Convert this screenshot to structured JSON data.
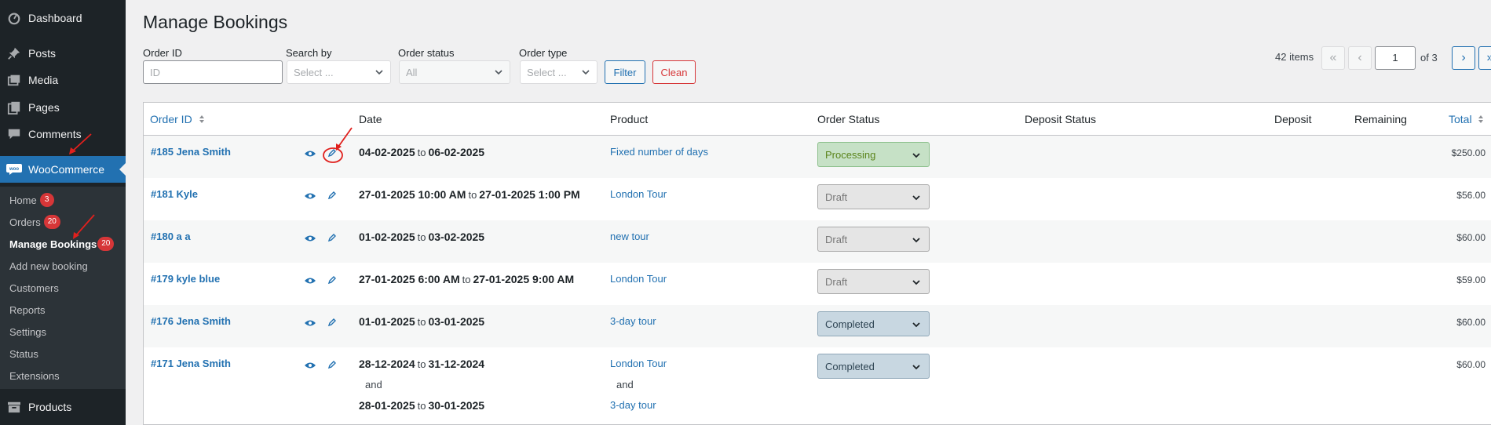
{
  "sidebar": {
    "menu": [
      {
        "label": "Dashboard",
        "icon": "dashboard-icon"
      },
      {
        "label": "Posts",
        "icon": "pin-icon"
      },
      {
        "label": "Media",
        "icon": "media-icon"
      },
      {
        "label": "Pages",
        "icon": "pages-icon"
      },
      {
        "label": "Comments",
        "icon": "comment-icon"
      },
      {
        "label": "WooCommerce",
        "icon": "woo-icon"
      }
    ],
    "submenu": [
      {
        "label": "Home",
        "badge": "3"
      },
      {
        "label": "Orders",
        "badge": "20"
      },
      {
        "label": "Manage Bookings",
        "badge": "20"
      },
      {
        "label": "Add new booking"
      },
      {
        "label": "Customers"
      },
      {
        "label": "Reports"
      },
      {
        "label": "Settings"
      },
      {
        "label": "Status"
      },
      {
        "label": "Extensions"
      }
    ],
    "products": {
      "label": "Products",
      "icon": "archive-icon"
    }
  },
  "page": {
    "title": "Manage Bookings"
  },
  "filters": {
    "order_id_label": "Order ID",
    "order_id_placeholder": "ID",
    "search_by_label": "Search by",
    "search_by_value": "Select ...",
    "order_status_label": "Order status",
    "order_status_value": "All",
    "order_type_label": "Order type",
    "order_type_value": "Select ...",
    "filter_button": "Filter",
    "clean_button": "Clean"
  },
  "pagination": {
    "items": "42 items",
    "first": "«",
    "prev": "‹",
    "current": "1",
    "of": "of 3",
    "next": "›",
    "last": "»"
  },
  "table": {
    "headers": {
      "order_id": "Order ID",
      "date": "Date",
      "product": "Product",
      "order_status": "Order Status",
      "deposit_status": "Deposit Status",
      "deposit": "Deposit",
      "remaining": "Remaining",
      "total": "Total"
    },
    "rows": [
      {
        "order": "#185 Jena Smith",
        "date1_from": "04-02-2025",
        "date1_to": "06-02-2025",
        "product1": "Fixed number of days",
        "status": "Processing",
        "total": "$250.00"
      },
      {
        "order": "#181 Kyle",
        "date1_from": "27-01-2025 10:00 AM",
        "date1_to": "27-01-2025 1:00 PM",
        "product1": "London Tour",
        "status": "Draft",
        "total": "$56.00"
      },
      {
        "order": "#180 a a",
        "date1_from": "01-02-2025",
        "date1_to": "03-02-2025",
        "product1": "new tour",
        "status": "Draft",
        "total": "$60.00"
      },
      {
        "order": "#179 kyle blue",
        "date1_from": "27-01-2025 6:00 AM",
        "date1_to": "27-01-2025 9:00 AM",
        "product1": "London Tour",
        "status": "Draft",
        "total": "$59.00"
      },
      {
        "order": "#176 Jena Smith",
        "date1_from": "01-01-2025",
        "date1_to": "03-01-2025",
        "product1": "3-day tour",
        "status": "Completed",
        "total": "$60.00"
      },
      {
        "order": "#171 Jena Smith",
        "date1_from": "28-12-2024",
        "date1_to": "31-12-2024",
        "and": "and",
        "date2_from": "28-01-2025",
        "date2_to": "30-01-2025",
        "product1": "London Tour",
        "product2": "3-day tour",
        "status": "Completed",
        "total": "$60.00"
      }
    ],
    "date_separator": "to"
  },
  "colors": {
    "sidebar_bg": "#1d2327",
    "accent": "#2271b1",
    "badge": "#d63638",
    "processing_bg": "#c6e1c6",
    "completed_bg": "#c8d7e1",
    "annotation": "#e0201d"
  }
}
